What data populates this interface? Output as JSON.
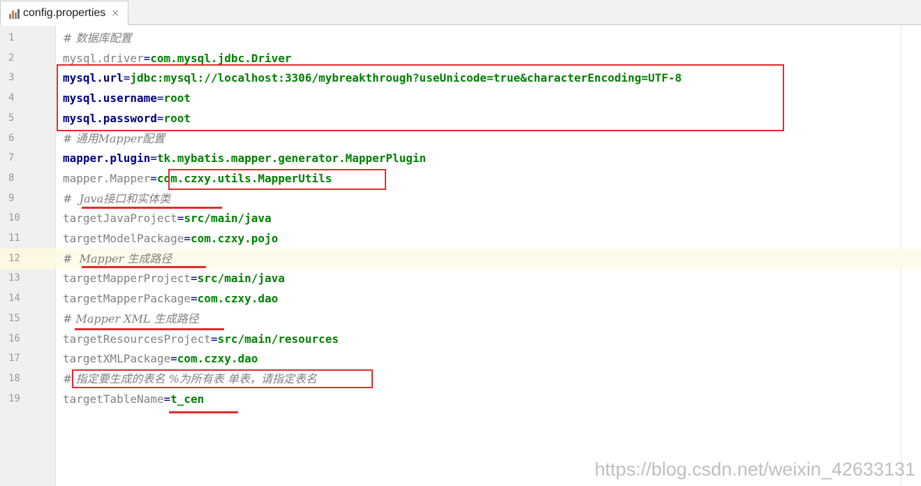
{
  "tab": {
    "title": "config.properties",
    "close": "×"
  },
  "lines": [
    {
      "num": "1",
      "comment": "# 数据库配置"
    },
    {
      "num": "2",
      "key": "mysql.driver",
      "eq": "=",
      "value": "com.mysql.jdbc.Driver",
      "dim": true
    },
    {
      "num": "3",
      "key": "mysql.url",
      "eq": "=",
      "value": "jdbc:mysql://localhost:3306/mybreakthrough?useUnicode=true&characterEncoding=UTF-8"
    },
    {
      "num": "4",
      "key": "mysql.username",
      "eq": "=",
      "value": "root"
    },
    {
      "num": "5",
      "key": "mysql.password",
      "eq": "=",
      "value": "root"
    },
    {
      "num": "6",
      "comment": "# 通用Mapper配置"
    },
    {
      "num": "7",
      "key": "mapper.plugin",
      "eq": "=",
      "value": "tk.mybatis.mapper.generator.MapperPlugin"
    },
    {
      "num": "8",
      "key": "mapper.Mapper",
      "eq": "=",
      "value": "com.czxy.utils.MapperUtils",
      "dim": true
    },
    {
      "num": "9",
      "comment": "#  Java接口和实体类"
    },
    {
      "num": "10",
      "key": "targetJavaProject",
      "eq": "=",
      "value": "src/main/java",
      "dim": true
    },
    {
      "num": "11",
      "key": "targetModelPackage",
      "eq": "=",
      "value": "com.czxy.pojo",
      "dim": true
    },
    {
      "num": "12",
      "comment": "#  Mapper 生成路径"
    },
    {
      "num": "13",
      "key": "targetMapperProject",
      "eq": "=",
      "value": "src/main/java",
      "dim": true
    },
    {
      "num": "14",
      "key": "targetMapperPackage",
      "eq": "=",
      "value": "com.czxy.dao",
      "dim": true
    },
    {
      "num": "15",
      "comment": "# Mapper XML 生成路径"
    },
    {
      "num": "16",
      "key": "targetResourcesProject",
      "eq": "=",
      "value": "src/main/resources",
      "dim": true
    },
    {
      "num": "17",
      "key": "targetXMLPackage",
      "eq": "=",
      "value": "com.czxy.dao",
      "dim": true
    },
    {
      "num": "18",
      "comment": "# 指定要生成的表名 %为所有表 单表，请指定表名"
    },
    {
      "num": "19",
      "key": "targetTableName",
      "eq": "=",
      "value": "t_cen",
      "dim": true
    }
  ],
  "current_line": "12",
  "watermark": "https://blog.csdn.net/weixin_42633131",
  "colors": {
    "annotation_red": "#e22b2b",
    "key": "#000080",
    "value": "#008000",
    "comment": "#808080",
    "current_line_bg": "#fdfbe9"
  }
}
